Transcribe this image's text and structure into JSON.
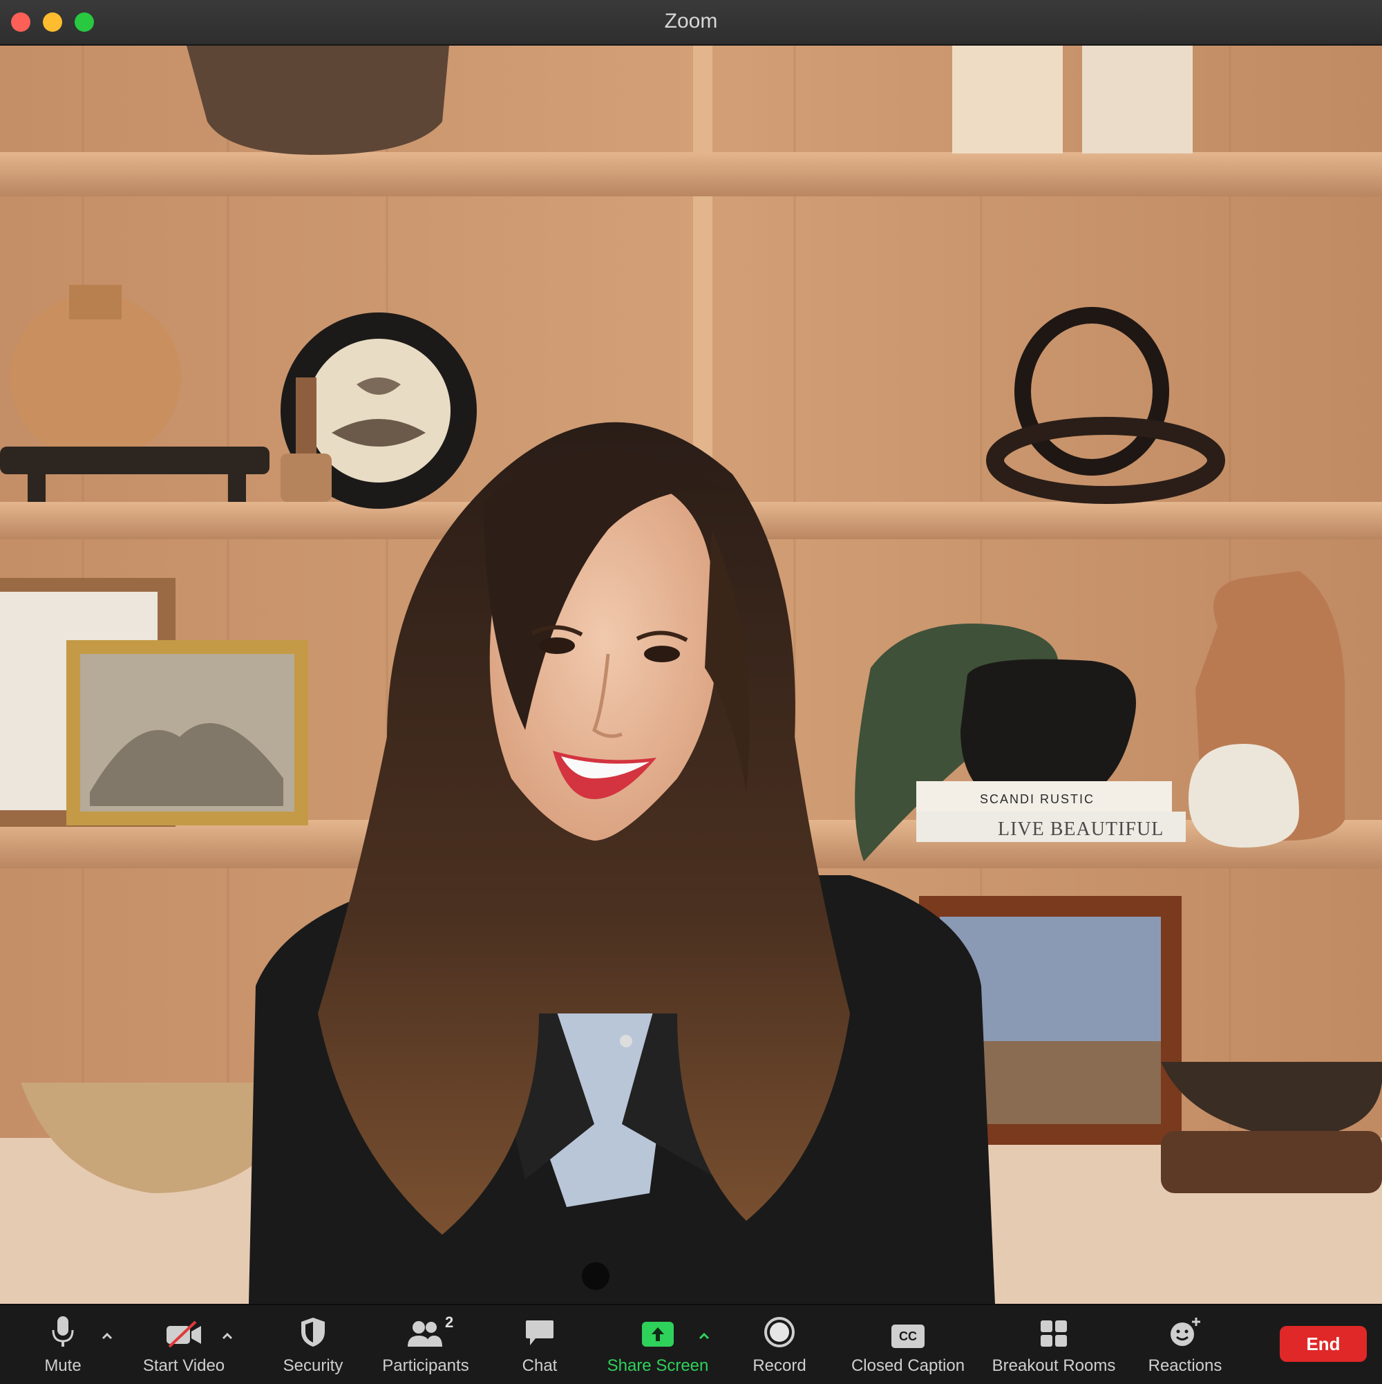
{
  "window": {
    "title": "Zoom"
  },
  "background": {
    "books": [
      {
        "title": "SCANDI RUSTIC"
      },
      {
        "title": "LIVE BEAUTIFUL"
      }
    ]
  },
  "toolbar": {
    "mute_label": "Mute",
    "start_video_label": "Start Video",
    "security_label": "Security",
    "participants_label": "Participants",
    "participants_count": "2",
    "chat_label": "Chat",
    "share_screen_label": "Share Screen",
    "record_label": "Record",
    "closed_caption_label": "Closed Caption",
    "cc_icon_text": "CC",
    "breakout_rooms_label": "Breakout Rooms",
    "reactions_label": "Reactions",
    "end_label": "End"
  },
  "colors": {
    "share_screen_accent": "#2ed15a",
    "end_button": "#e02828",
    "toolbar_bg": "#1a1a1a"
  },
  "icons": [
    "microphone-icon",
    "video-off-icon",
    "shield-icon",
    "participants-icon",
    "chat-bubble-icon",
    "share-screen-icon",
    "record-icon",
    "closed-caption-icon",
    "breakout-rooms-icon",
    "reactions-icon",
    "caret-up-icon"
  ]
}
